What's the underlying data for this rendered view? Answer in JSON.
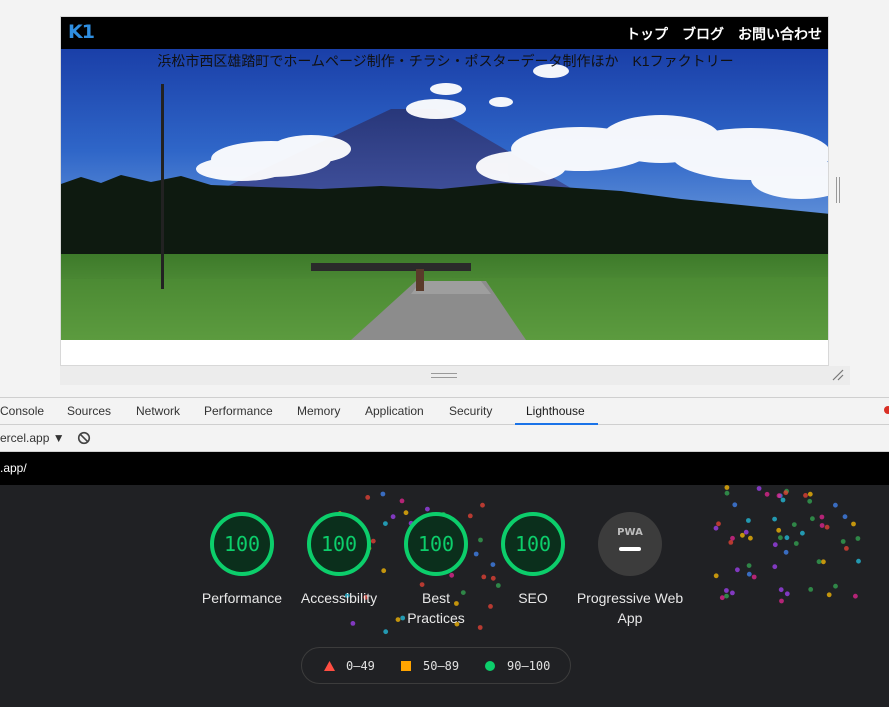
{
  "site": {
    "logo": "K1",
    "nav": [
      "トップ",
      "ブログ",
      "お問い合わせ"
    ],
    "hero_caption": "浜松市西区雄踏町でホームページ制作・チラシ・ポスターデータ制作ほか　K1ファクトリー"
  },
  "devtools": {
    "tabs": [
      "Console",
      "Sources",
      "Network",
      "Performance",
      "Memory",
      "Application",
      "Security",
      "Lighthouse"
    ],
    "active_tab": "Lighthouse",
    "url_select": "ercel.app ▼",
    "report_url": ".app/"
  },
  "lighthouse": {
    "scores": [
      {
        "label": "Performance",
        "score": "100"
      },
      {
        "label": "Accessibility",
        "score": "100"
      },
      {
        "label": "Best Practices",
        "score": "100"
      },
      {
        "label": "SEO",
        "score": "100"
      }
    ],
    "pwa": {
      "badge": "PWA",
      "label": "Progressive Web App"
    },
    "legend": [
      {
        "range": "0–49",
        "color": "#ff4e42"
      },
      {
        "range": "50–89",
        "color": "#ffa400"
      },
      {
        "range": "90–100",
        "color": "#0cce6b"
      }
    ],
    "colors": {
      "pass": "#0cce6b",
      "pass_text": "#0cce6b",
      "background": "#202124"
    }
  }
}
